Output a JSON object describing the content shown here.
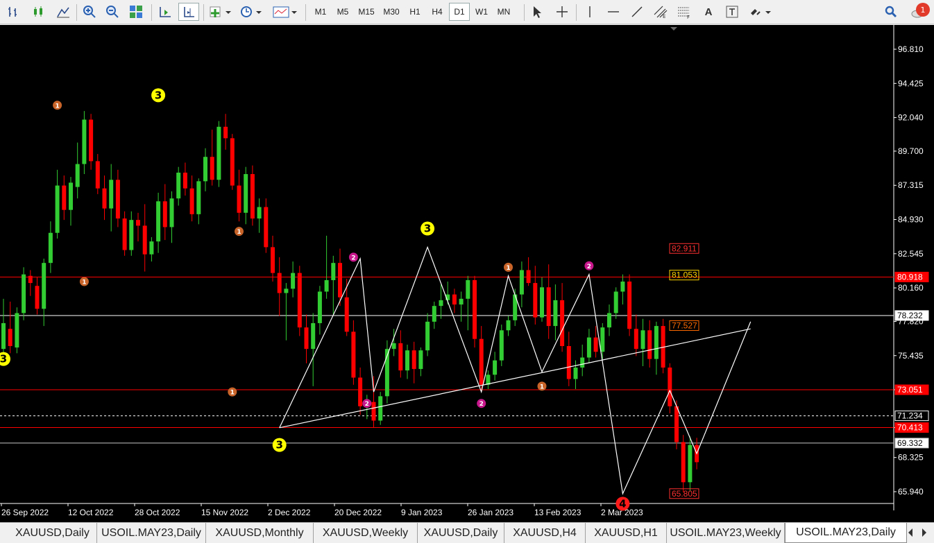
{
  "toolbar": {
    "timeframes": [
      "M1",
      "M5",
      "M15",
      "M30",
      "H1",
      "H4",
      "D1",
      "W1",
      "MN"
    ],
    "active_timeframe": "D1",
    "text_tool_label": "A",
    "alert_count": "1"
  },
  "chart": {
    "symbol": "USOIL.MAY23",
    "timeframe": "Daily",
    "price_scale": [
      "96.810",
      "94.425",
      "92.040",
      "89.700",
      "87.315",
      "84.930",
      "82.545",
      "80.160",
      "77.820",
      "75.435",
      "73.051",
      "70.413",
      "68.325",
      "65.940"
    ],
    "time_scale": [
      "26 Sep 2022",
      "12 Oct 2022",
      "28 Oct 2022",
      "15 Nov 2022",
      "2 Dec 2022",
      "20 Dec 2022",
      "9 Jan 2023",
      "26 Jan 2023",
      "13 Feb 2023",
      "2 Mar 2023"
    ],
    "levels": [
      {
        "price": 80.918,
        "label": "80.918",
        "color": "#ff0000",
        "style": "solid",
        "tag_bg": "#ff0000",
        "tag_fg": "#ffffff"
      },
      {
        "price": 78.232,
        "label": "78.232",
        "color": "#ffffff",
        "style": "solid",
        "tag_bg": "#ffffff",
        "tag_fg": "#000000"
      },
      {
        "price": 73.051,
        "label": "73.051",
        "color": "#ff0000",
        "style": "solid",
        "tag_bg": "#ff0000",
        "tag_fg": "#ffffff"
      },
      {
        "price": 71.234,
        "label": "71.234",
        "color": "#ffffff",
        "style": "dashed",
        "tag_bg": "#000000",
        "tag_fg": "#ffffff"
      },
      {
        "price": 70.413,
        "label": "70.413",
        "color": "#ff0000",
        "style": "solid",
        "tag_bg": "#ff0000",
        "tag_fg": "#ffffff"
      },
      {
        "price": 69.332,
        "label": "69.332",
        "color": "#c8c8c8",
        "style": "solid",
        "tag_bg": "#ffffff",
        "tag_fg": "#000000"
      }
    ],
    "projection_labels": [
      {
        "price": 82.911,
        "label": "82.911",
        "color": "#ff3030"
      },
      {
        "price": 81.053,
        "label": "81.053",
        "color": "#ffd700"
      },
      {
        "price": 77.527,
        "label": "77.527",
        "color": "#ff6a00"
      },
      {
        "price": 65.805,
        "label": "65.805",
        "color": "#ff3030"
      }
    ],
    "wave_markers": [
      {
        "label": "1",
        "color": "#c8642a",
        "size": "small",
        "time_index": 8,
        "price": 92.9
      },
      {
        "label": "3",
        "color": "#ffff00",
        "size": "large",
        "time_index": 23,
        "price": 93.6
      },
      {
        "label": "1",
        "color": "#c8642a",
        "size": "small",
        "time_index": 12,
        "price": 80.6
      },
      {
        "label": "3",
        "color": "#ffff00",
        "size": "large",
        "time_index": 0,
        "price": 75.2
      },
      {
        "label": "1",
        "color": "#c8642a",
        "size": "small",
        "time_index": 35,
        "price": 84.1
      },
      {
        "label": "1",
        "color": "#c8642a",
        "size": "small",
        "time_index": 34,
        "price": 72.9
      },
      {
        "label": "3",
        "color": "#ffff00",
        "size": "large",
        "time_index": 41,
        "price": 69.2
      },
      {
        "label": "2",
        "color": "#c8168c",
        "size": "small",
        "time_index": 52,
        "price": 82.3
      },
      {
        "label": "2",
        "color": "#c8168c",
        "size": "small",
        "time_index": 54,
        "price": 72.1
      },
      {
        "label": "3",
        "color": "#ffff00",
        "size": "large",
        "time_index": 63,
        "price": 84.3
      },
      {
        "label": "2",
        "color": "#c8168c",
        "size": "small",
        "time_index": 71,
        "price": 72.1
      },
      {
        "label": "1",
        "color": "#c8642a",
        "size": "small",
        "time_index": 75,
        "price": 81.6
      },
      {
        "label": "1",
        "color": "#c8642a",
        "size": "small",
        "time_index": 80,
        "price": 73.3
      },
      {
        "label": "2",
        "color": "#c8168c",
        "size": "small",
        "time_index": 87,
        "price": 81.7
      },
      {
        "label": "4",
        "color": "#ff1a1a",
        "size": "large",
        "time_index": 92,
        "price": 65.1
      }
    ],
    "zigzag": [
      [
        41,
        70.4
      ],
      [
        53,
        82.2
      ],
      [
        55,
        72.9
      ],
      [
        63,
        83.0
      ],
      [
        71,
        72.9
      ],
      [
        75,
        81.0
      ],
      [
        80,
        74.3
      ],
      [
        87,
        81.1
      ],
      [
        92,
        65.8
      ],
      [
        99,
        73.0
      ],
      [
        103,
        68.6
      ],
      [
        111,
        77.8
      ]
    ],
    "trendline": [
      [
        41,
        70.4
      ],
      [
        111,
        77.3
      ]
    ],
    "candles": [
      {
        "o": 75.9,
        "h": 79.4,
        "l": 74.8,
        "c": 77.7
      },
      {
        "o": 77.3,
        "h": 79.2,
        "l": 75.6,
        "c": 76.1
      },
      {
        "o": 76.0,
        "h": 78.8,
        "l": 75.6,
        "c": 78.4
      },
      {
        "o": 78.4,
        "h": 81.6,
        "l": 77.9,
        "c": 81.1
      },
      {
        "o": 81.0,
        "h": 81.4,
        "l": 79.6,
        "c": 80.5
      },
      {
        "o": 80.3,
        "h": 80.9,
        "l": 78.3,
        "c": 78.7
      },
      {
        "o": 78.7,
        "h": 82.2,
        "l": 77.5,
        "c": 81.9
      },
      {
        "o": 81.9,
        "h": 84.8,
        "l": 81.2,
        "c": 84.0
      },
      {
        "o": 84.0,
        "h": 88.4,
        "l": 83.6,
        "c": 87.3
      },
      {
        "o": 87.3,
        "h": 88.0,
        "l": 84.9,
        "c": 85.6
      },
      {
        "o": 85.6,
        "h": 87.9,
        "l": 84.5,
        "c": 87.5
      },
      {
        "o": 87.2,
        "h": 90.3,
        "l": 86.4,
        "c": 88.8
      },
      {
        "o": 88.8,
        "h": 92.5,
        "l": 88.1,
        "c": 91.9
      },
      {
        "o": 91.9,
        "h": 92.3,
        "l": 88.4,
        "c": 89.0
      },
      {
        "o": 89.0,
        "h": 89.5,
        "l": 86.7,
        "c": 87.1
      },
      {
        "o": 87.1,
        "h": 88.0,
        "l": 84.9,
        "c": 85.7
      },
      {
        "o": 85.7,
        "h": 88.8,
        "l": 84.1,
        "c": 87.7
      },
      {
        "o": 87.7,
        "h": 88.4,
        "l": 84.4,
        "c": 85.0
      },
      {
        "o": 85.0,
        "h": 85.5,
        "l": 82.4,
        "c": 82.8
      },
      {
        "o": 82.8,
        "h": 85.5,
        "l": 82.4,
        "c": 84.9
      },
      {
        "o": 84.9,
        "h": 85.4,
        "l": 83.4,
        "c": 84.5
      },
      {
        "o": 84.5,
        "h": 86.0,
        "l": 81.3,
        "c": 82.5
      },
      {
        "o": 82.5,
        "h": 83.7,
        "l": 82.0,
        "c": 83.4
      },
      {
        "o": 83.4,
        "h": 86.8,
        "l": 82.6,
        "c": 86.2
      },
      {
        "o": 86.2,
        "h": 87.4,
        "l": 83.5,
        "c": 84.4
      },
      {
        "o": 84.4,
        "h": 86.9,
        "l": 83.3,
        "c": 86.4
      },
      {
        "o": 86.4,
        "h": 88.6,
        "l": 85.9,
        "c": 88.2
      },
      {
        "o": 88.2,
        "h": 88.9,
        "l": 86.6,
        "c": 87.1
      },
      {
        "o": 87.1,
        "h": 88.0,
        "l": 84.8,
        "c": 85.3
      },
      {
        "o": 85.3,
        "h": 87.8,
        "l": 84.6,
        "c": 87.6
      },
      {
        "o": 87.6,
        "h": 89.9,
        "l": 86.9,
        "c": 89.3
      },
      {
        "o": 89.3,
        "h": 91.2,
        "l": 87.3,
        "c": 87.7
      },
      {
        "o": 87.7,
        "h": 91.8,
        "l": 87.2,
        "c": 91.4
      },
      {
        "o": 91.4,
        "h": 92.3,
        "l": 89.8,
        "c": 90.6
      },
      {
        "o": 90.6,
        "h": 90.9,
        "l": 87.0,
        "c": 87.3
      },
      {
        "o": 87.3,
        "h": 88.4,
        "l": 84.8,
        "c": 85.4
      },
      {
        "o": 85.4,
        "h": 88.6,
        "l": 84.6,
        "c": 88.1
      },
      {
        "o": 88.1,
        "h": 88.7,
        "l": 84.5,
        "c": 85.0
      },
      {
        "o": 85.0,
        "h": 86.4,
        "l": 84.0,
        "c": 85.8
      },
      {
        "o": 85.8,
        "h": 86.4,
        "l": 82.6,
        "c": 83.0
      },
      {
        "o": 83.0,
        "h": 83.8,
        "l": 80.6,
        "c": 81.2
      },
      {
        "o": 81.2,
        "h": 82.3,
        "l": 78.2,
        "c": 79.8
      },
      {
        "o": 79.8,
        "h": 80.5,
        "l": 76.5,
        "c": 80.1
      },
      {
        "o": 80.1,
        "h": 82.0,
        "l": 79.5,
        "c": 81.2
      },
      {
        "o": 81.2,
        "h": 81.7,
        "l": 76.8,
        "c": 77.4
      },
      {
        "o": 77.4,
        "h": 78.3,
        "l": 74.9,
        "c": 75.9
      },
      {
        "o": 75.9,
        "h": 78.4,
        "l": 73.3,
        "c": 77.7
      },
      {
        "o": 77.7,
        "h": 80.3,
        "l": 76.9,
        "c": 79.9
      },
      {
        "o": 79.9,
        "h": 83.8,
        "l": 79.4,
        "c": 80.7
      },
      {
        "o": 80.7,
        "h": 82.4,
        "l": 78.3,
        "c": 81.9
      },
      {
        "o": 81.9,
        "h": 82.9,
        "l": 78.9,
        "c": 79.5
      },
      {
        "o": 79.5,
        "h": 80.8,
        "l": 76.8,
        "c": 77.1
      },
      {
        "o": 77.1,
        "h": 77.9,
        "l": 73.4,
        "c": 73.9
      },
      {
        "o": 73.9,
        "h": 74.6,
        "l": 71.3,
        "c": 71.9
      },
      {
        "o": 71.9,
        "h": 72.7,
        "l": 71.0,
        "c": 72.2
      },
      {
        "o": 72.2,
        "h": 74.0,
        "l": 70.4,
        "c": 70.9
      },
      {
        "o": 70.9,
        "h": 72.9,
        "l": 70.6,
        "c": 72.6
      },
      {
        "o": 72.6,
        "h": 76.5,
        "l": 72.1,
        "c": 75.9
      },
      {
        "o": 75.9,
        "h": 77.3,
        "l": 75.4,
        "c": 76.3
      },
      {
        "o": 76.3,
        "h": 77.2,
        "l": 73.9,
        "c": 74.4
      },
      {
        "o": 74.4,
        "h": 76.2,
        "l": 73.8,
        "c": 75.8
      },
      {
        "o": 75.8,
        "h": 76.4,
        "l": 73.5,
        "c": 74.5
      },
      {
        "o": 74.5,
        "h": 76.0,
        "l": 74.0,
        "c": 75.8
      },
      {
        "o": 75.8,
        "h": 78.4,
        "l": 75.4,
        "c": 77.8
      },
      {
        "o": 77.8,
        "h": 79.2,
        "l": 77.3,
        "c": 78.9
      },
      {
        "o": 78.9,
        "h": 80.4,
        "l": 78.0,
        "c": 79.3
      },
      {
        "o": 79.3,
        "h": 80.6,
        "l": 79.0,
        "c": 79.7
      },
      {
        "o": 79.7,
        "h": 80.1,
        "l": 78.4,
        "c": 79.0
      },
      {
        "o": 79.0,
        "h": 79.9,
        "l": 77.8,
        "c": 79.4
      },
      {
        "o": 79.4,
        "h": 81.0,
        "l": 77.2,
        "c": 80.7
      },
      {
        "o": 80.7,
        "h": 81.0,
        "l": 76.0,
        "c": 76.6
      },
      {
        "o": 76.6,
        "h": 77.5,
        "l": 72.9,
        "c": 73.4
      },
      {
        "o": 73.4,
        "h": 74.4,
        "l": 73.1,
        "c": 74.1
      },
      {
        "o": 74.1,
        "h": 75.7,
        "l": 73.7,
        "c": 75.1
      },
      {
        "o": 75.1,
        "h": 77.6,
        "l": 74.7,
        "c": 77.2
      },
      {
        "o": 77.2,
        "h": 78.2,
        "l": 76.8,
        "c": 77.9
      },
      {
        "o": 77.9,
        "h": 80.1,
        "l": 77.5,
        "c": 79.7
      },
      {
        "o": 79.7,
        "h": 82.0,
        "l": 78.8,
        "c": 81.4
      },
      {
        "o": 81.4,
        "h": 82.3,
        "l": 80.3,
        "c": 80.5
      },
      {
        "o": 80.5,
        "h": 81.7,
        "l": 77.6,
        "c": 78.1
      },
      {
        "o": 78.1,
        "h": 80.9,
        "l": 77.8,
        "c": 80.2
      },
      {
        "o": 80.2,
        "h": 81.8,
        "l": 76.6,
        "c": 77.5
      },
      {
        "o": 77.5,
        "h": 80.4,
        "l": 76.5,
        "c": 79.3
      },
      {
        "o": 79.3,
        "h": 80.5,
        "l": 75.7,
        "c": 76.1
      },
      {
        "o": 76.1,
        "h": 77.1,
        "l": 73.3,
        "c": 73.8
      },
      {
        "o": 73.8,
        "h": 75.1,
        "l": 73.1,
        "c": 74.6
      },
      {
        "o": 74.6,
        "h": 76.2,
        "l": 74.0,
        "c": 75.3
      },
      {
        "o": 75.3,
        "h": 77.3,
        "l": 74.9,
        "c": 76.7
      },
      {
        "o": 76.7,
        "h": 77.5,
        "l": 75.3,
        "c": 75.7
      },
      {
        "o": 75.7,
        "h": 77.7,
        "l": 75.2,
        "c": 77.4
      },
      {
        "o": 77.4,
        "h": 79.0,
        "l": 76.8,
        "c": 78.4
      },
      {
        "o": 78.4,
        "h": 80.2,
        "l": 78.0,
        "c": 79.9
      },
      {
        "o": 79.9,
        "h": 81.1,
        "l": 79.0,
        "c": 80.6
      },
      {
        "o": 80.6,
        "h": 81.1,
        "l": 76.8,
        "c": 77.3
      },
      {
        "o": 77.3,
        "h": 78.3,
        "l": 75.4,
        "c": 75.9
      },
      {
        "o": 75.9,
        "h": 78.0,
        "l": 74.7,
        "c": 77.2
      },
      {
        "o": 77.2,
        "h": 77.9,
        "l": 74.6,
        "c": 75.2
      },
      {
        "o": 75.2,
        "h": 77.8,
        "l": 74.1,
        "c": 77.5
      },
      {
        "o": 77.5,
        "h": 78.0,
        "l": 74.2,
        "c": 74.6
      },
      {
        "o": 74.6,
        "h": 74.9,
        "l": 71.4,
        "c": 71.9
      },
      {
        "o": 71.9,
        "h": 72.3,
        "l": 68.9,
        "c": 69.4
      },
      {
        "o": 69.4,
        "h": 69.9,
        "l": 65.9,
        "c": 66.6
      },
      {
        "o": 66.6,
        "h": 69.8,
        "l": 66.0,
        "c": 69.2
      },
      {
        "o": 69.2,
        "h": 69.7,
        "l": 67.5,
        "c": 68.0
      }
    ]
  },
  "tabs": [
    {
      "label": "XAUUSD,Daily",
      "active": false
    },
    {
      "label": "USOIL.MAY23,Daily",
      "active": false
    },
    {
      "label": "XAUUSD,Monthly",
      "active": false
    },
    {
      "label": "XAUUSD,Weekly",
      "active": false
    },
    {
      "label": "XAUUSD,Daily",
      "active": false
    },
    {
      "label": "XAUUSD,H4",
      "active": false
    },
    {
      "label": "XAUUSD,H1",
      "active": false
    },
    {
      "label": "USOIL.MAY23,Weekly",
      "active": false
    },
    {
      "label": "USOIL.MAY23,Daily",
      "active": true
    }
  ],
  "colors": {
    "bull": "#32cd32",
    "bear": "#ff0000",
    "background": "#000000",
    "axis_text": "#ffffff",
    "zigzag": "#ffffff"
  }
}
